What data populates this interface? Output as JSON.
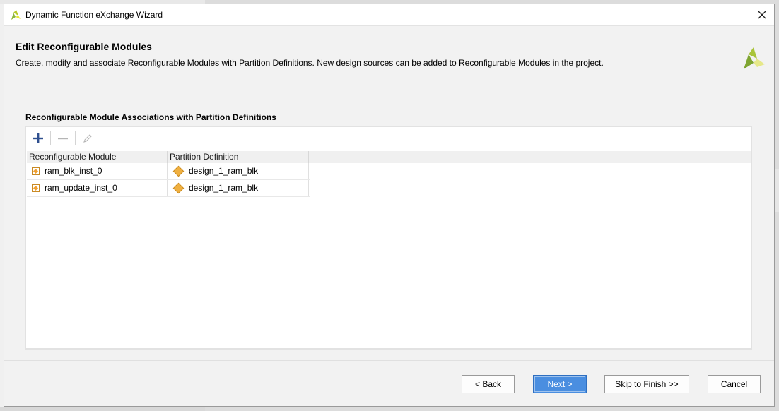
{
  "window": {
    "title": "Dynamic Function eXchange Wizard"
  },
  "header": {
    "title": "Edit Reconfigurable Modules",
    "description": "Create, modify and associate Reconfigurable Modules with Partition Definitions. New design sources can be added to Reconfigurable Modules in the project."
  },
  "section": {
    "label": "Reconfigurable Module Associations with Partition Definitions"
  },
  "toolbar": {
    "icons": [
      "add-icon",
      "remove-icon",
      "edit-icon"
    ]
  },
  "table": {
    "columns": [
      "Reconfigurable Module",
      "Partition Definition"
    ],
    "rows": [
      {
        "module": "ram_blk_inst_0",
        "partition": "design_1_ram_blk"
      },
      {
        "module": "ram_update_inst_0",
        "partition": "design_1_ram_blk"
      }
    ]
  },
  "buttons": {
    "back_pre": "< ",
    "back_key": "B",
    "back_post": "ack",
    "next_key": "N",
    "next_post": "ext >",
    "skip_key": "S",
    "skip_post": "kip to Finish >>",
    "cancel": "Cancel"
  },
  "colors": {
    "accent": "#4a8ee0",
    "logo_green": "#8db53c",
    "logo_yellow": "#e6e639"
  }
}
